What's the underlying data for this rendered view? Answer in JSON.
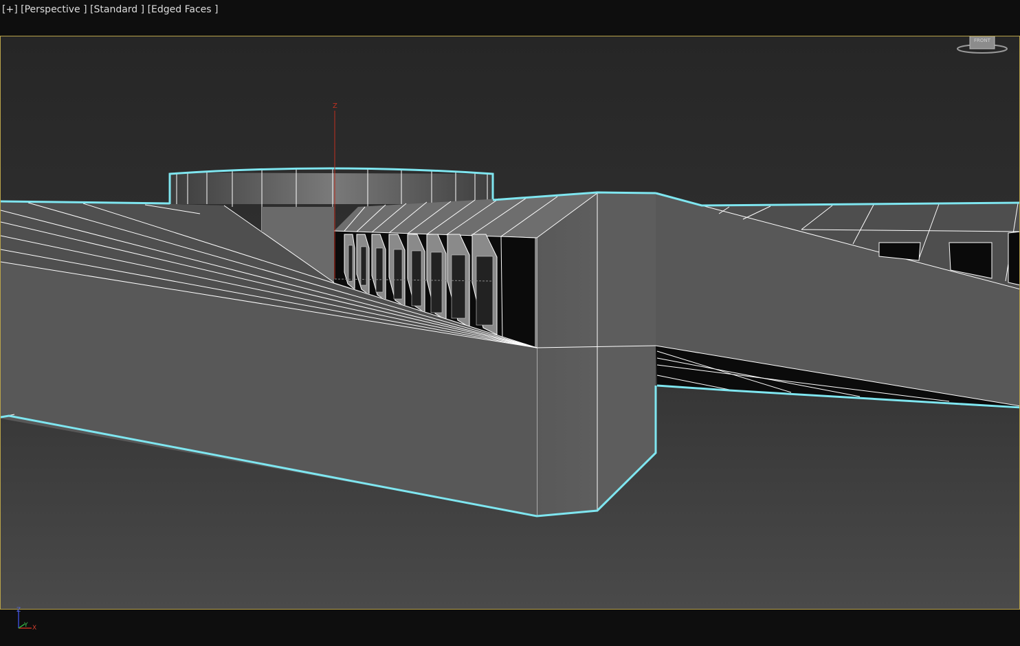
{
  "viewport": {
    "menu_label": "[+]",
    "pov_label": "[Perspective ]",
    "shading_label": "[Standard ]",
    "style_label": "[Edged Faces ]"
  },
  "gizmo": {
    "z_label": "Z"
  },
  "viewcube": {
    "face_label": "FRONT"
  },
  "tripod": {
    "z": "Z",
    "y": "Y",
    "x": "X"
  },
  "colors": {
    "background": "#0e0e0e",
    "viewport_bg": "#2b2b2b",
    "active_border": "#b9a34a",
    "selection_outline": "#7fe6f0",
    "edge": "#ffffff"
  }
}
